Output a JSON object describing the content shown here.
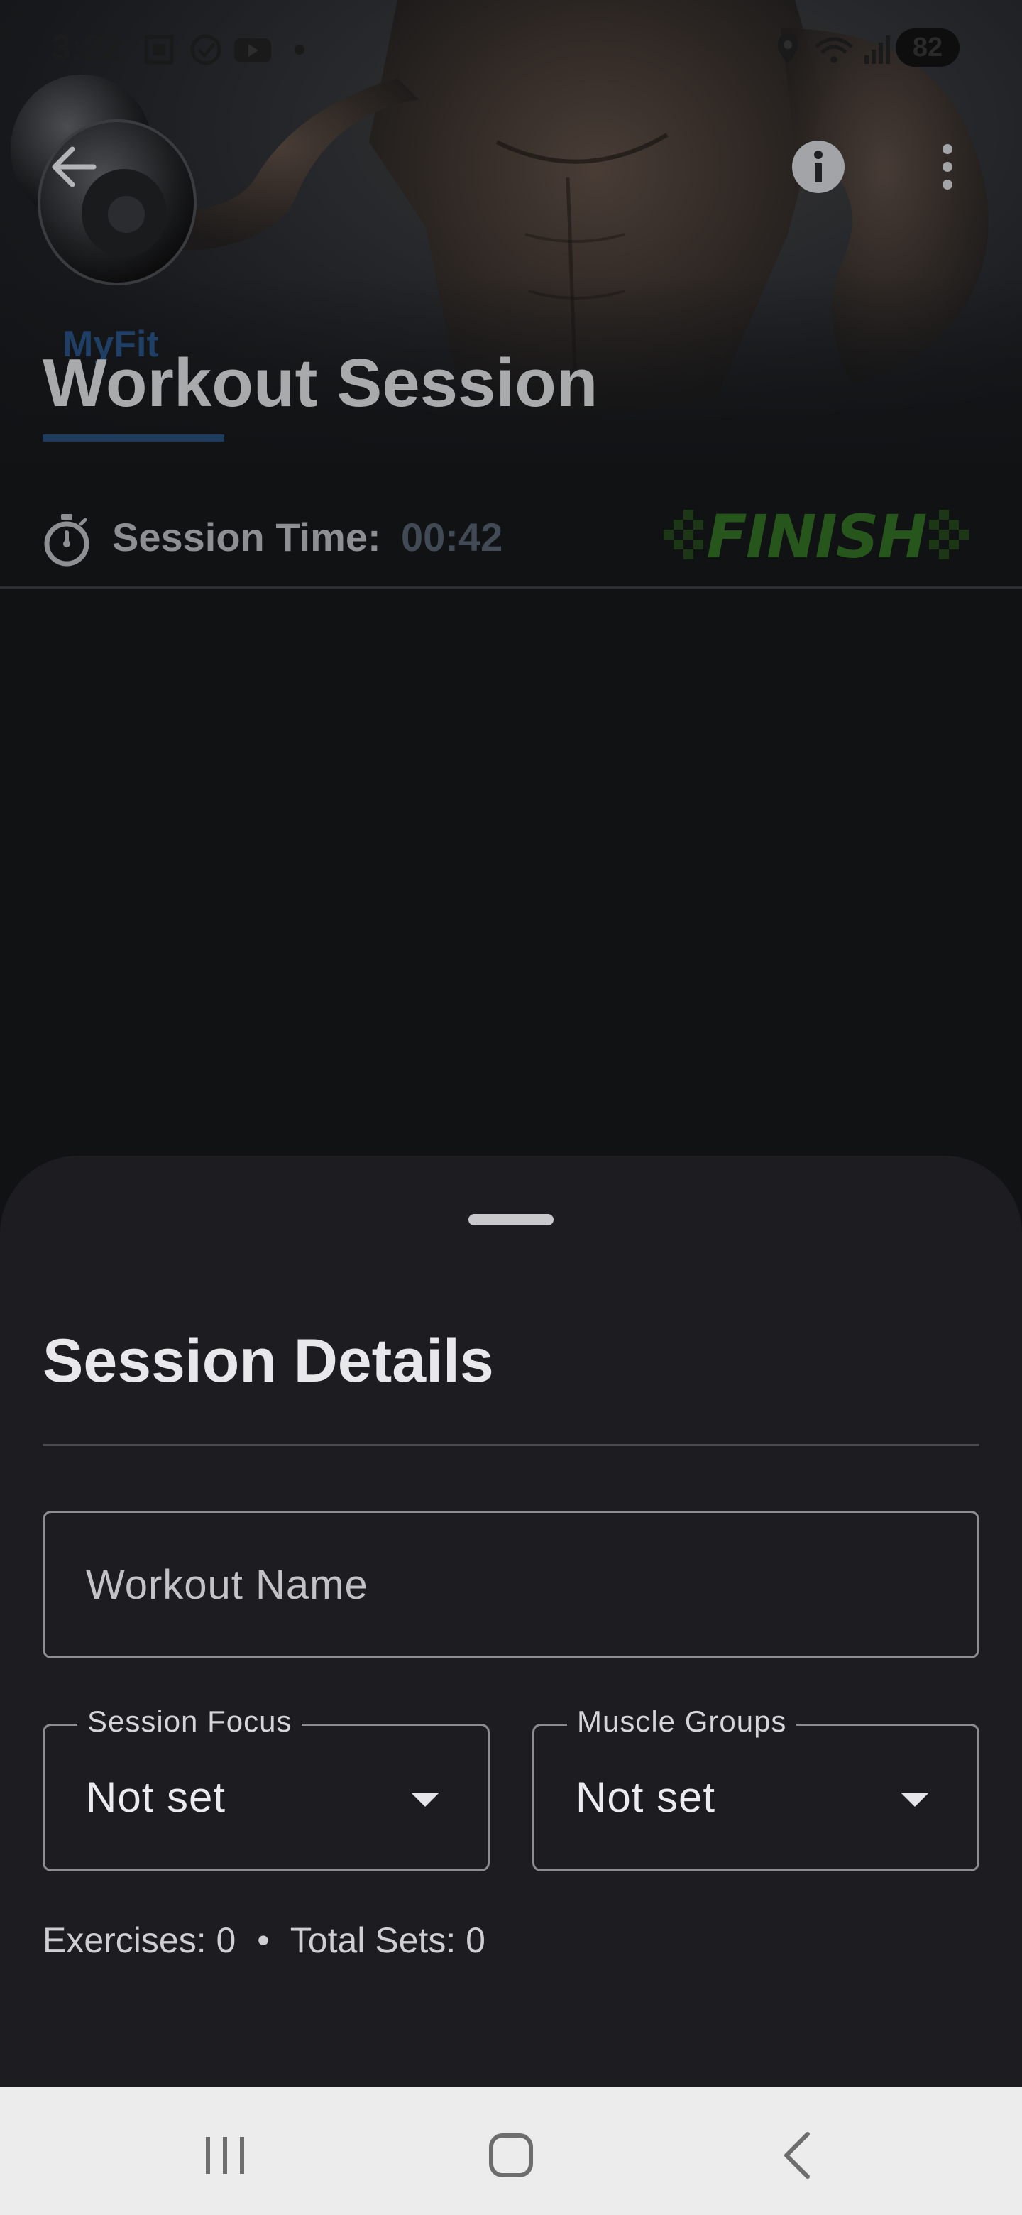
{
  "status_bar": {
    "time": "3:22",
    "battery": "82",
    "left_icons": [
      "screenshot-icon",
      "check-circle-icon",
      "youtube-icon",
      "dot-icon"
    ],
    "right_icons": [
      "location-icon",
      "wifi-icon",
      "signal-icon"
    ]
  },
  "app_bar": {
    "brand": "MyFit",
    "title": "Workout Session",
    "icons": [
      "back-arrow-icon",
      "info-icon",
      "more-vert-icon"
    ]
  },
  "session": {
    "time_label": "Session Time:",
    "time_value": "00:42",
    "finish_label": "FINISH"
  },
  "sheet": {
    "title": "Session Details",
    "workout_name_placeholder": "Workout Name",
    "workout_name_value": "",
    "session_focus": {
      "label": "Session Focus",
      "value": "Not set"
    },
    "muscle_groups": {
      "label": "Muscle Groups",
      "value": "Not set"
    },
    "summary": {
      "exercises_label": "Exercises:",
      "exercises_count": "0",
      "separator": "•",
      "sets_label": "Total Sets:",
      "sets_count": "0"
    }
  },
  "nav_bar": {
    "icons": [
      "recent-apps-icon",
      "home-icon",
      "back-icon"
    ]
  },
  "colors": {
    "sheet_bg": "#1d1c21",
    "screen_bg": "#111214",
    "brand_blue": "#1f3f66",
    "finish_green": "#27561c",
    "nav_bg": "#ececec"
  }
}
